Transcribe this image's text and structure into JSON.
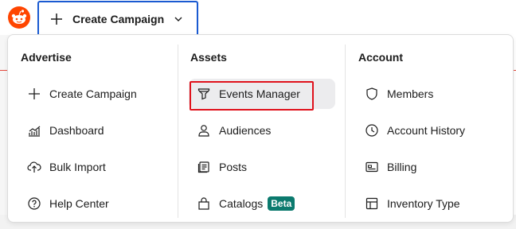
{
  "header": {
    "create_button_label": "Create Campaign"
  },
  "menu": {
    "advertise": {
      "title": "Advertise",
      "items": [
        {
          "label": "Create Campaign",
          "icon": "plus-icon"
        },
        {
          "label": "Dashboard",
          "icon": "dashboard-chart-icon"
        },
        {
          "label": "Bulk Import",
          "icon": "upload-cloud-icon"
        },
        {
          "label": "Help Center",
          "icon": "help-circle-icon"
        }
      ]
    },
    "assets": {
      "title": "Assets",
      "items": [
        {
          "label": "Events Manager",
          "icon": "funnel-icon",
          "highlighted": true
        },
        {
          "label": "Audiences",
          "icon": "person-icon"
        },
        {
          "label": "Posts",
          "icon": "posts-icon"
        },
        {
          "label": "Catalogs",
          "icon": "bag-icon",
          "badge": "Beta"
        }
      ]
    },
    "account": {
      "title": "Account",
      "items": [
        {
          "label": "Members",
          "icon": "shield-icon"
        },
        {
          "label": "Account History",
          "icon": "clock-icon"
        },
        {
          "label": "Billing",
          "icon": "card-icon"
        },
        {
          "label": "Inventory Type",
          "icon": "grid-icon"
        }
      ]
    }
  },
  "colors": {
    "accent_blue": "#1a5ad1",
    "highlight_red": "#e0121c",
    "beta_green": "#0b7a6e",
    "reddit_orange": "#ff4500"
  }
}
